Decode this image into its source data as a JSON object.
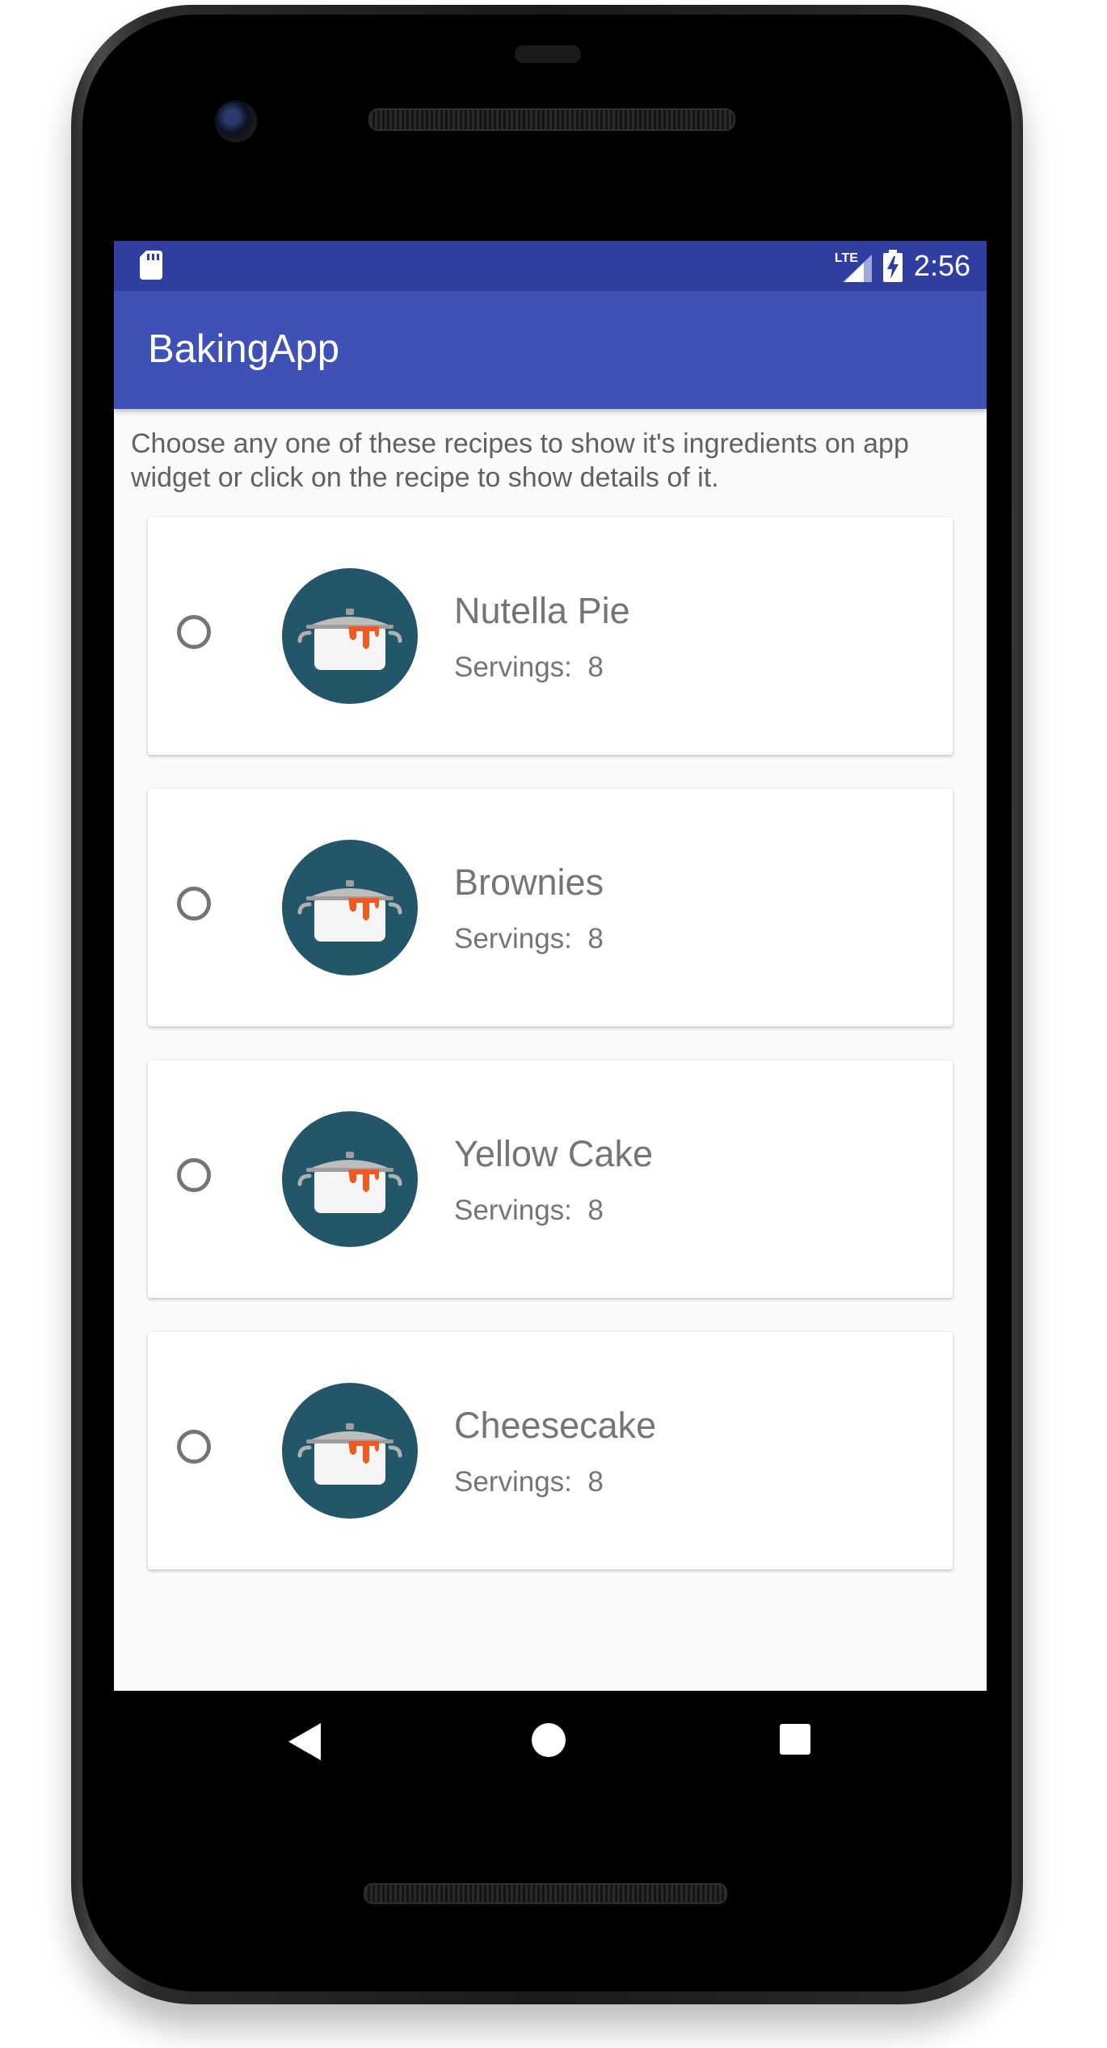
{
  "status_bar": {
    "network": "LTE",
    "time": "2:56"
  },
  "app_bar": {
    "title": "BakingApp"
  },
  "hint": "Choose any one of these recipes to show it's ingredients on app widget or click on the recipe to show details of it.",
  "recipes": [
    {
      "name": "Nutella Pie",
      "servings_label": "Servings:  8",
      "selected": false,
      "image_icon": "cooking-pot-icon"
    },
    {
      "name": "Brownies",
      "servings_label": "Servings:  8",
      "selected": false,
      "image_icon": "cooking-pot-icon"
    },
    {
      "name": "Yellow Cake",
      "servings_label": "Servings:  8",
      "selected": false,
      "image_icon": "cooking-pot-icon"
    },
    {
      "name": "Cheesecake",
      "servings_label": "Servings:  8",
      "selected": false,
      "image_icon": "cooking-pot-icon"
    }
  ],
  "nav_bar": {
    "back_icon": "back-triangle-icon",
    "home_icon": "home-circle-icon",
    "recents_icon": "recents-square-icon"
  },
  "colors": {
    "status_bar": "#303f9f",
    "app_bar": "#3f51b5",
    "thumb_background": "#235668",
    "sauce": "#f05a22"
  }
}
